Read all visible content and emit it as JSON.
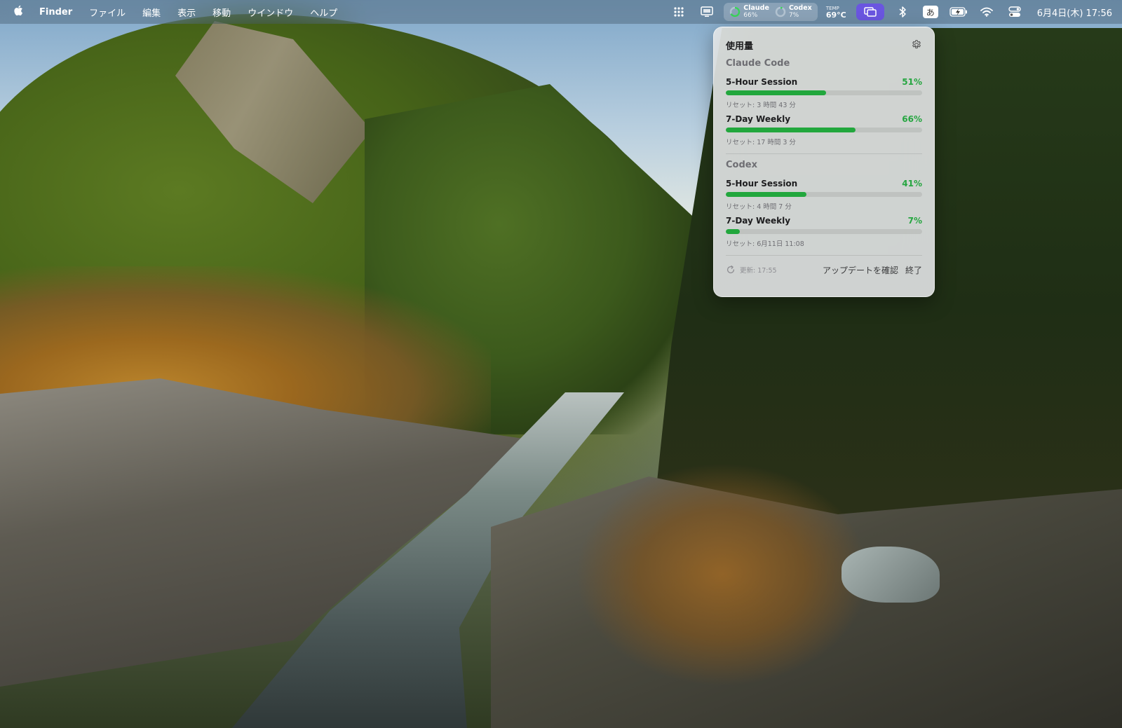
{
  "menubar": {
    "app_name": "Finder",
    "menus": [
      "ファイル",
      "編集",
      "表示",
      "移動",
      "ウインドウ",
      "ヘルプ"
    ],
    "usage_pill": {
      "claude_label": "Claude",
      "claude_pct": "66%",
      "codex_label": "Codex",
      "codex_pct": "7%"
    },
    "temp_label": "TEMP",
    "temp_value": "69°C",
    "ime_label": "あ",
    "clock": "6月4日(木) 17:56"
  },
  "popover": {
    "title": "使用量",
    "sections": [
      {
        "title": "Claude Code",
        "metrics": [
          {
            "name": "5-Hour Session",
            "percent_label": "51%",
            "percent": 51,
            "reset": "リセット: 3 時間 43 分"
          },
          {
            "name": "7-Day Weekly",
            "percent_label": "66%",
            "percent": 66,
            "reset": "リセット: 17 時間 3 分"
          }
        ]
      },
      {
        "title": "Codex",
        "metrics": [
          {
            "name": "5-Hour Session",
            "percent_label": "41%",
            "percent": 41,
            "reset": "リセット: 4 時間 7 分"
          },
          {
            "name": "7-Day Weekly",
            "percent_label": "7%",
            "percent": 7,
            "reset": "リセット: 6月11日 11:08"
          }
        ]
      }
    ],
    "updated": "更新: 17:55",
    "check_updates": "アップデートを確認",
    "quit": "終了"
  },
  "colors": {
    "accent_green": "#22a73d",
    "active_badge": "#6a56e0"
  },
  "icons": [
    "apple-icon",
    "dots-grid-icon",
    "display-icon",
    "claude-ring-icon",
    "codex-ring-icon",
    "screen-mirror-icon",
    "bluetooth-icon",
    "battery-charging-icon",
    "wifi-icon",
    "control-center-icon",
    "gear-icon",
    "refresh-icon"
  ]
}
